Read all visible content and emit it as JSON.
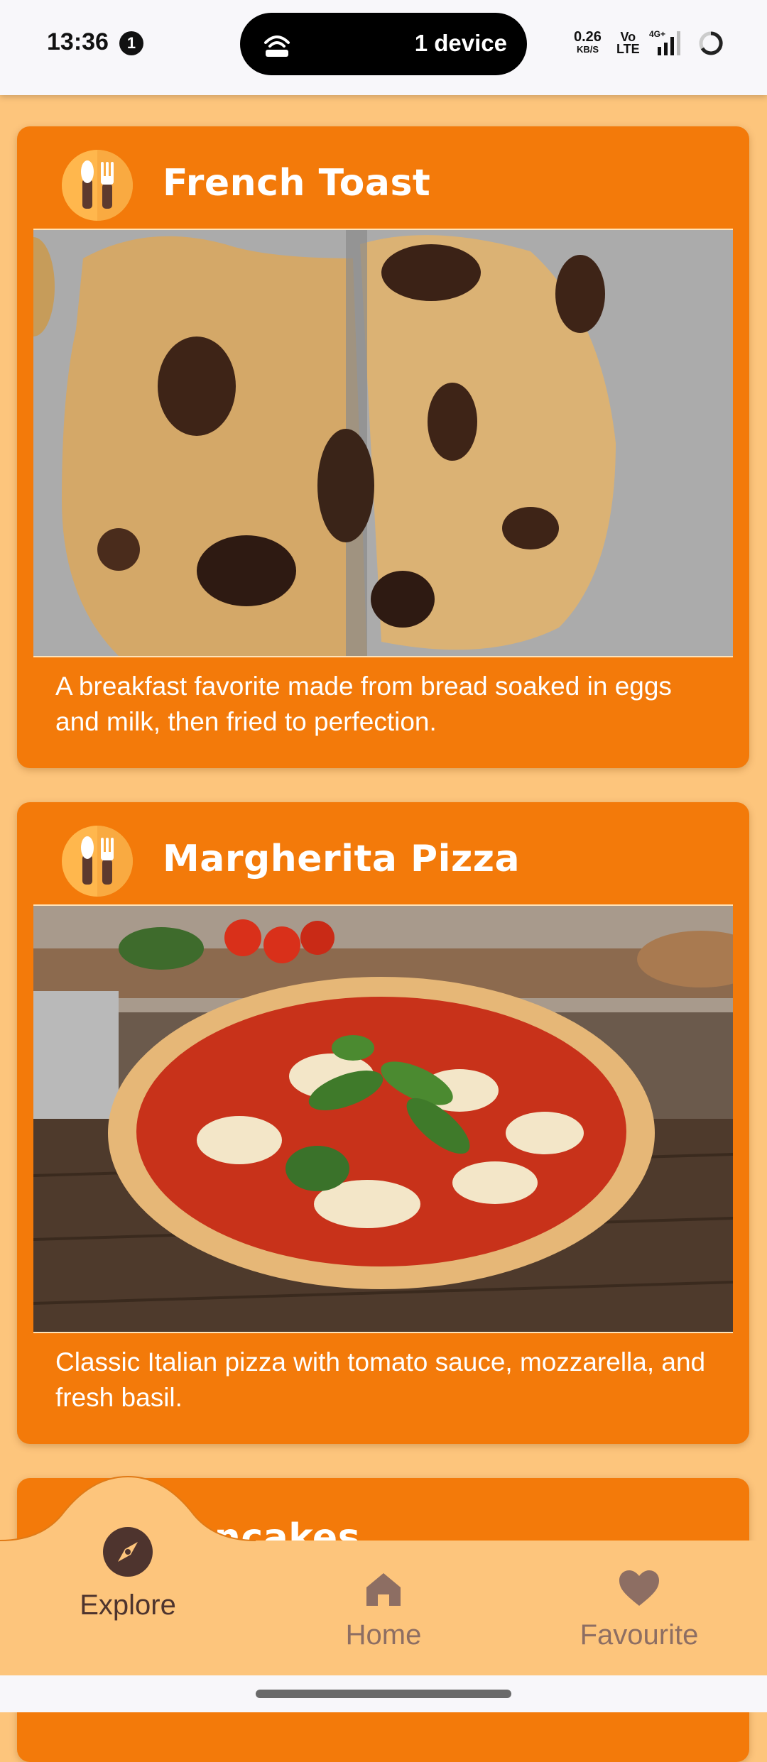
{
  "status_bar": {
    "time": "13:36",
    "notification_count": "1",
    "hotspot_text": "1 device",
    "net_speed_value": "0.26",
    "net_speed_unit": "KB/S",
    "volte_top": "Vo",
    "volte_bottom": "LTE",
    "network_type": "4G+"
  },
  "recipes": [
    {
      "title": "French Toast",
      "image_icon": "chocolate-chip-cookie-photo",
      "description": "A breakfast favorite made from bread soaked in eggs and milk, then fried to perfection."
    },
    {
      "title": "Margherita Pizza",
      "image_icon": "margherita-pizza-photo",
      "description": "Classic Italian pizza with tomato sauce, mozzarella, and fresh basil."
    },
    {
      "title": "Pancakes"
    }
  ],
  "bottom_nav": {
    "items": [
      {
        "label": "Explore",
        "icon": "compass-icon",
        "active": true
      },
      {
        "label": "Home",
        "icon": "home-icon",
        "active": false
      },
      {
        "label": "Favourite",
        "icon": "heart-icon",
        "active": false
      }
    ]
  },
  "colors": {
    "card": "#F37A0A",
    "background": "#FDC57C",
    "nav_active": "#4E342E",
    "nav_inactive": "#8D6E63"
  }
}
